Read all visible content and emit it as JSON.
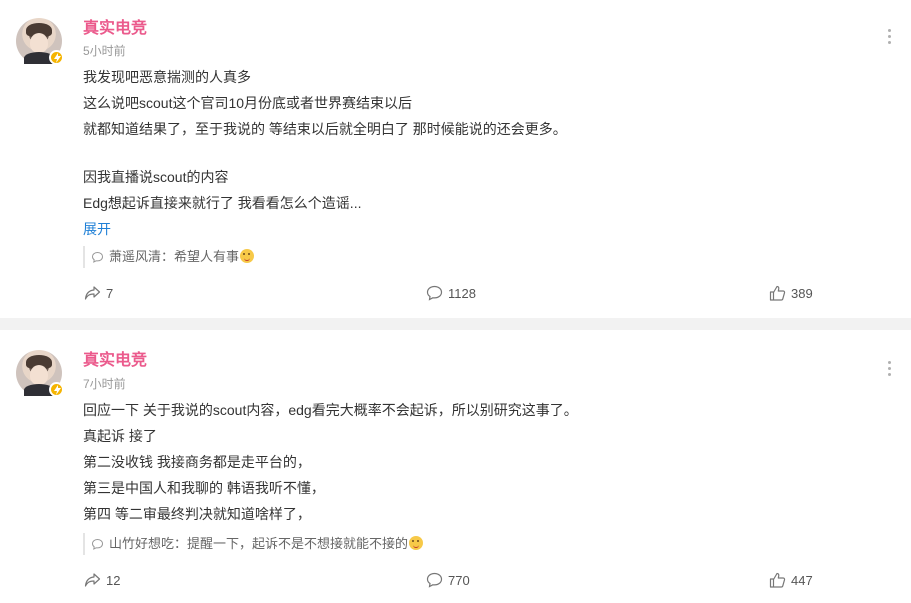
{
  "posts": [
    {
      "username": "真实电竞",
      "time": "5小时前",
      "lines": [
        "我发现吧恶意揣测的人真多",
        "这么说吧scout这个官司10月份底或者世界赛结束以后",
        "就都知道结果了，至于我说的 等结束以后就全明白了 那时候能说的还会更多。",
        "",
        "因我直播说scout的内容",
        "Edg想起诉直接来就行了  我看看怎么个造谣..."
      ],
      "expand_label": "展开",
      "comment_preview": {
        "author": "萧遥风清",
        "text": "希望人有事"
      },
      "actions": {
        "shares": "7",
        "comments": "1128",
        "likes": "389"
      }
    },
    {
      "username": "真实电竞",
      "time": "7小时前",
      "lines": [
        "回应一下 关于我说的scout内容，edg看完大概率不会起诉，所以别研究这事了。",
        "真起诉 接了",
        "第二没收钱  我接商务都是走平台的，",
        "第三是中国人和我聊的  韩语我听不懂，",
        "第四 等二审最终判决就知道啥样了，"
      ],
      "comment_preview": {
        "author": "山竹好想吃",
        "text": "提醒一下，起诉不是不想接就能不接的"
      },
      "actions": {
        "shares": "12",
        "comments": "770",
        "likes": "447"
      }
    }
  ],
  "icons": {
    "more": "more-vertical-icon",
    "verified": "verified-badge-icon",
    "share": "share-arrow-icon",
    "comment": "comment-bubble-icon",
    "like": "thumbs-up-icon"
  },
  "colors": {
    "username": "#eb5a8c",
    "link": "#1e7fd6",
    "badge": "#f5b400",
    "separator": "#f2f2f2"
  }
}
